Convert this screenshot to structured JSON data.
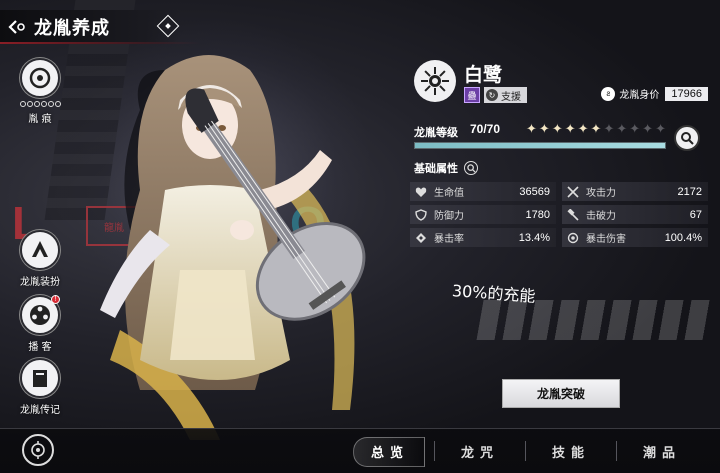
{
  "header": {
    "title": "龙胤养成"
  },
  "left_menu": [
    {
      "label": "胤 痕"
    },
    {
      "label": "龙胤装扮"
    },
    {
      "label": "播 客",
      "badge": "!"
    },
    {
      "label": "龙胤传记"
    }
  ],
  "background": {
    "logo_left": "L",
    "stamp_text": "龍胤",
    "logo_right": "O"
  },
  "character": {
    "name": "白鹭",
    "attribute_badge": "蠱",
    "role": "支援",
    "value_label": "龙胤身价",
    "value": "17966"
  },
  "level": {
    "label": "龙胤等级",
    "value": "70/70",
    "stars_total": 11,
    "stars_filled": 6,
    "progress": 1.0
  },
  "stats": {
    "title": "基础属性",
    "items": [
      {
        "label": "生命值",
        "value": "36569",
        "icon": "heart-icon"
      },
      {
        "label": "攻击力",
        "value": "2172",
        "icon": "crossed-swords-icon"
      },
      {
        "label": "防御力",
        "value": "1780",
        "icon": "shield-icon"
      },
      {
        "label": "击破力",
        "value": "67",
        "icon": "hammer-icon"
      },
      {
        "label": "暴击率",
        "value": "13.4%",
        "icon": "crit-rate-icon"
      },
      {
        "label": "暴击伤害",
        "value": "100.4%",
        "icon": "crit-damage-icon"
      }
    ]
  },
  "energy_note": "30%的充能",
  "breakthrough_button": "龙胤突破",
  "bottom_nav": {
    "tabs": [
      {
        "label": "总览",
        "active": true
      },
      {
        "label": "龙咒",
        "active": false
      },
      {
        "label": "技能",
        "active": false
      },
      {
        "label": "潮品",
        "active": false
      }
    ]
  },
  "colors": {
    "accent_red": "#b8323a",
    "teal": "#7cbcc4",
    "panel_dark": "#141419"
  }
}
